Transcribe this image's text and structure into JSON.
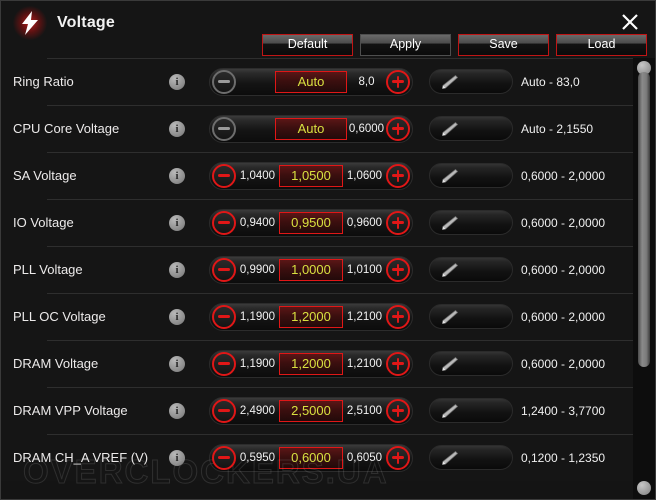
{
  "window": {
    "title": "Voltage",
    "icon": "lightning-bolt-icon",
    "close_label": "✕",
    "accent_red": "#e01717",
    "value_yellow": "#d8e040",
    "background": "#151515"
  },
  "toolbar": {
    "buttons": [
      {
        "label": "Default",
        "style": "red"
      },
      {
        "label": "Apply",
        "style": "gray"
      },
      {
        "label": "Save",
        "style": "red"
      },
      {
        "label": "Load",
        "style": "red"
      }
    ]
  },
  "info_icon_glyph": "i",
  "rows": [
    {
      "label": "Ring Ratio",
      "minus_enabled": false,
      "plus_enabled": true,
      "left_value": "",
      "value": "Auto",
      "right_value": "8,0",
      "range": "Auto - 83,0"
    },
    {
      "label": "CPU Core Voltage",
      "minus_enabled": false,
      "plus_enabled": true,
      "left_value": "",
      "value": "Auto",
      "right_value": "0,6000",
      "range": "Auto - 2,1550"
    },
    {
      "label": "SA Voltage",
      "minus_enabled": true,
      "plus_enabled": true,
      "left_value": "1,0400",
      "value": "1,0500",
      "right_value": "1,0600",
      "range": "0,6000 - 2,0000"
    },
    {
      "label": "IO Voltage",
      "minus_enabled": true,
      "plus_enabled": true,
      "left_value": "0,9400",
      "value": "0,9500",
      "right_value": "0,9600",
      "range": "0,6000 - 2,0000"
    },
    {
      "label": "PLL Voltage",
      "minus_enabled": true,
      "plus_enabled": true,
      "left_value": "0,9900",
      "value": "1,0000",
      "right_value": "1,0100",
      "range": "0,6000 - 2,0000"
    },
    {
      "label": "PLL OC Voltage",
      "minus_enabled": true,
      "plus_enabled": true,
      "left_value": "1,1900",
      "value": "1,2000",
      "right_value": "1,2100",
      "range": "0,6000 - 2,0000"
    },
    {
      "label": "DRAM Voltage",
      "minus_enabled": true,
      "plus_enabled": true,
      "left_value": "1,1900",
      "value": "1,2000",
      "right_value": "1,2100",
      "range": "0,6000 - 2,0000"
    },
    {
      "label": "DRAM VPP Voltage",
      "minus_enabled": true,
      "plus_enabled": true,
      "left_value": "2,4900",
      "value": "2,5000",
      "right_value": "2,5100",
      "range": "1,2400 - 3,7700"
    },
    {
      "label": "DRAM CH_A VREF (V)",
      "minus_enabled": true,
      "plus_enabled": true,
      "left_value": "0,5950",
      "value": "0,6000",
      "right_value": "0,6050",
      "range": "0,1200 - 1,2350"
    }
  ],
  "watermark": "OVERCLOCKERS.UA"
}
